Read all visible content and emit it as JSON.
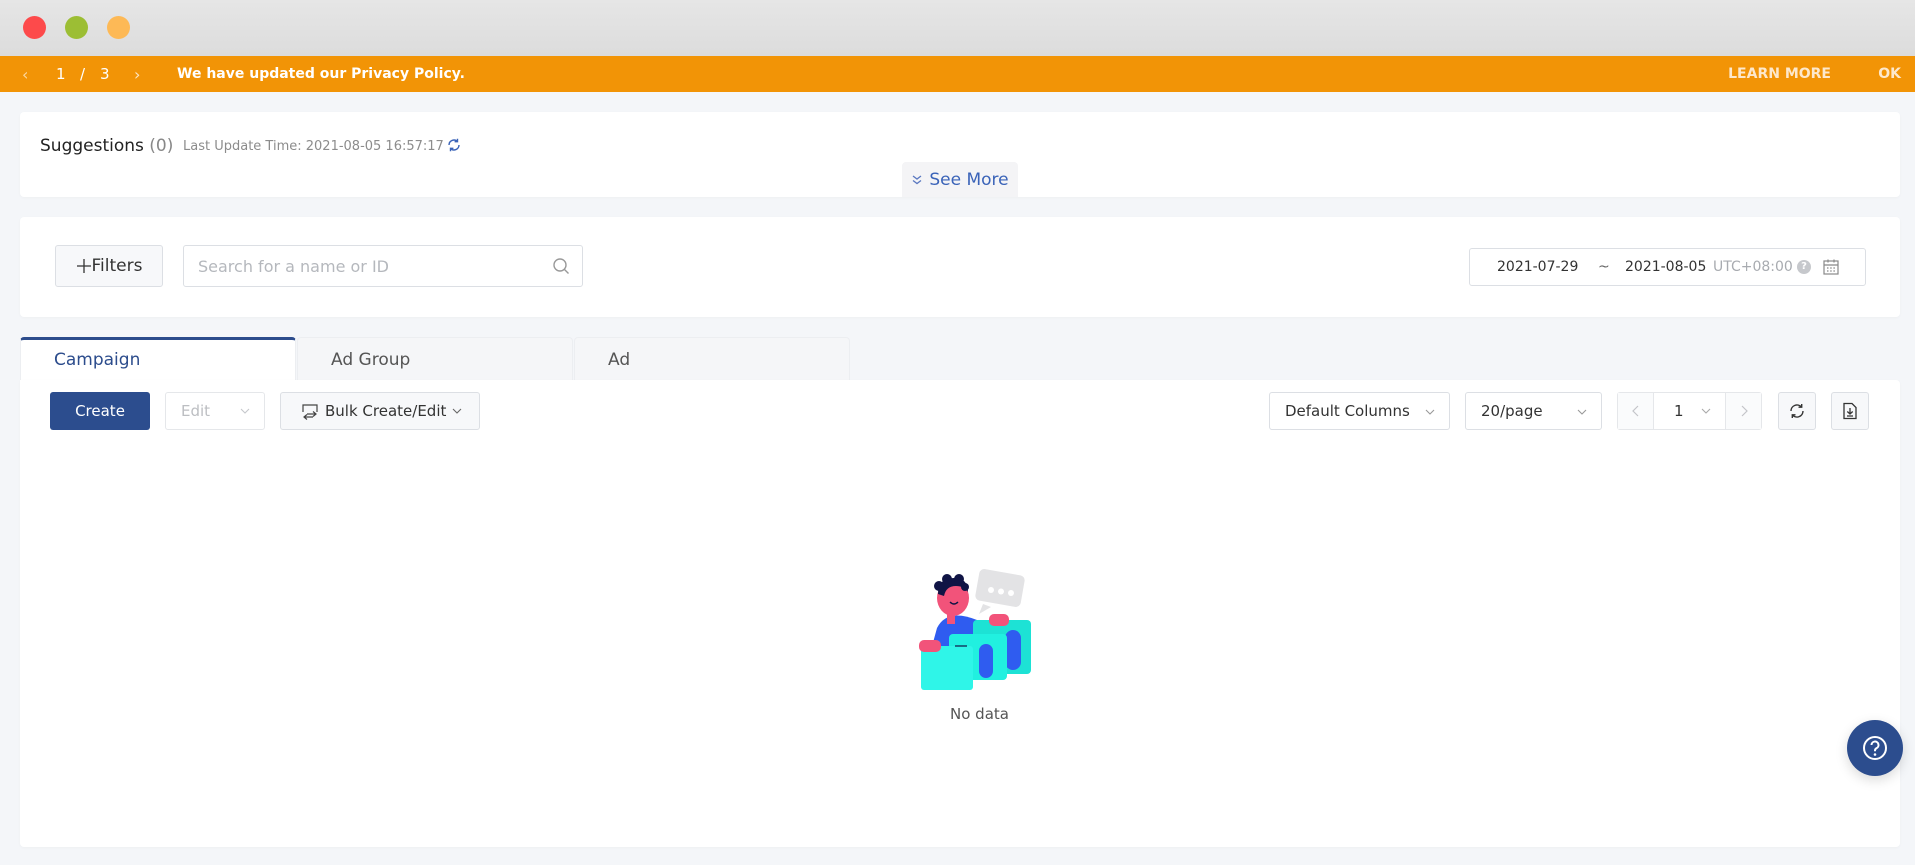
{
  "window": {
    "controls": [
      "close",
      "minimize",
      "maximize"
    ]
  },
  "banner": {
    "prev_icon": "chevron-left-icon",
    "current_page": "1",
    "separator": "/",
    "total_pages": "3",
    "next_icon": "chevron-right-icon",
    "message": "We have updated our Privacy Policy.",
    "learn_more": "LEARN MORE",
    "ok": "OK",
    "color": "#f29406"
  },
  "suggestions": {
    "title": "Suggestions",
    "count": "(0)",
    "last_update": "Last Update Time: 2021-08-05 16:57:17",
    "refresh_icon": "refresh-icon",
    "see_more": "See More"
  },
  "filters": {
    "add_filters": "Filters",
    "search_placeholder": "Search for a name or ID",
    "search_value": "",
    "date_start": "2021-07-29",
    "date_separator": "~",
    "date_end": "2021-08-05",
    "timezone": "UTC+08:00",
    "help_glyph": "?"
  },
  "tabs": [
    {
      "label": "Campaign",
      "active": true
    },
    {
      "label": "Ad Group",
      "active": false
    },
    {
      "label": "Ad",
      "active": false
    }
  ],
  "toolbar": {
    "create": "Create",
    "edit": "Edit",
    "bulk": "Bulk Create/Edit",
    "columns": "Default Columns",
    "page_size": "20/page",
    "current_page": "1"
  },
  "empty_state": {
    "label": "No data"
  },
  "colors": {
    "primary": "#2c4d8e",
    "accent_link": "#3a63b8",
    "banner": "#f29406"
  }
}
